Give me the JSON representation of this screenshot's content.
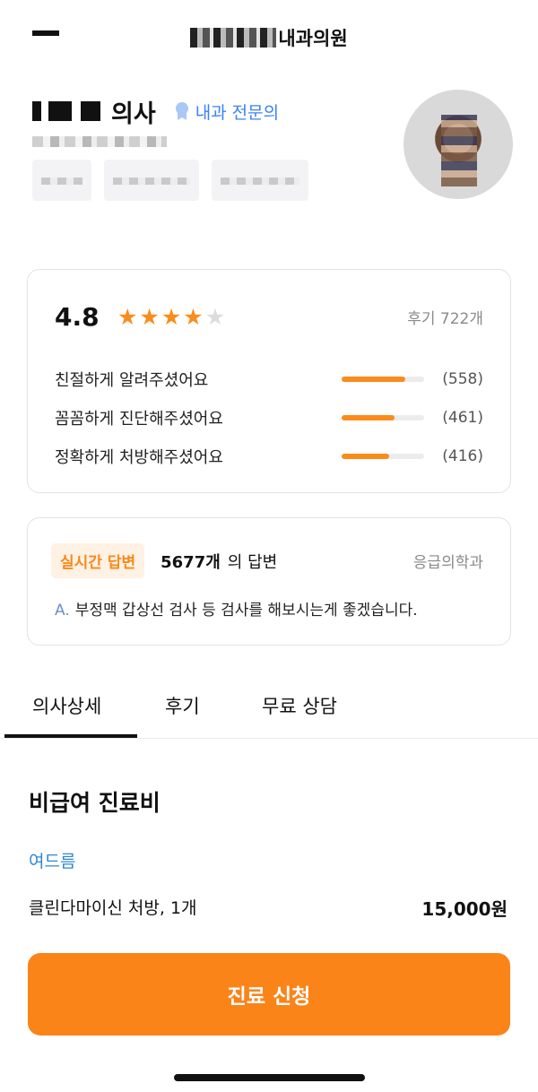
{
  "header": {
    "title_suffix": "내과의원"
  },
  "doctor": {
    "title": "의사",
    "badge": "내과 전문의"
  },
  "rating": {
    "score": "4.8",
    "stars": 4,
    "star_max": 5,
    "review_count": "후기 722개",
    "items": [
      {
        "label": "친절하게 알려주셨어요",
        "count": "(558)",
        "fraction": 0.77
      },
      {
        "label": "꼼꼼하게 진단해주셨어요",
        "count": "(461)",
        "fraction": 0.64
      },
      {
        "label": "정확하게 처방해주셨어요",
        "count": "(416)",
        "fraction": 0.58
      }
    ]
  },
  "answer": {
    "badge": "실시간 답변",
    "count": "5677개",
    "suffix": "의 답변",
    "department": "응급의학과",
    "prefix": "A.",
    "text": "부정맥 갑상선 검사 등  검사를 해보시는게 좋겠습니다."
  },
  "tabs": [
    {
      "label": "의사상세",
      "active": true
    },
    {
      "label": "후기",
      "active": false
    },
    {
      "label": "무료 상담",
      "active": false
    }
  ],
  "fee": {
    "title": "비급여 진료비",
    "category": "여드름",
    "item": "클린다마이신 처방, 1개",
    "price": "15,000원"
  },
  "cta": {
    "label": "진료 신청"
  },
  "colors": {
    "accent": "#fb8419",
    "link_blue": "#2f86d6",
    "badge_blue": "#3b82f6"
  }
}
